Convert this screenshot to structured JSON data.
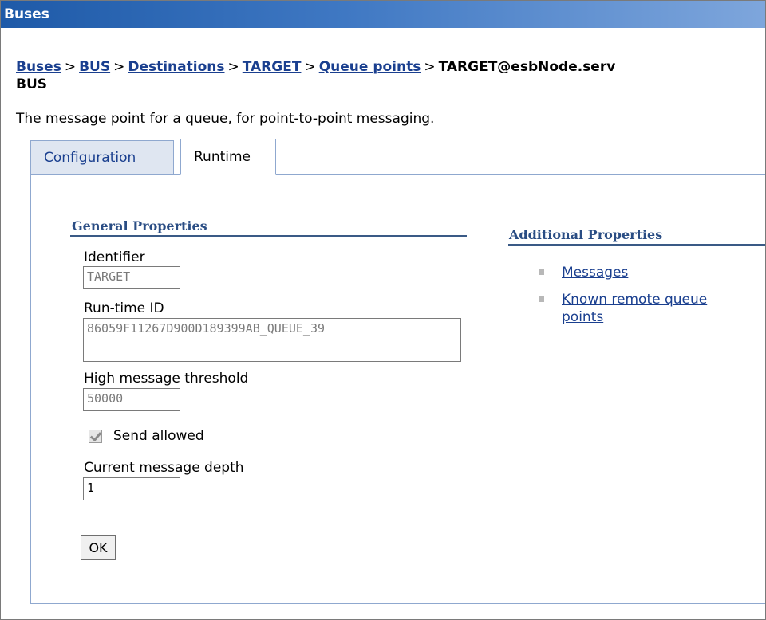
{
  "window": {
    "title": "Buses"
  },
  "breadcrumb": {
    "items": [
      {
        "label": "Buses",
        "link": true
      },
      {
        "label": "BUS",
        "link": true
      },
      {
        "label": "Destinations",
        "link": true
      },
      {
        "label": "TARGET",
        "link": true
      },
      {
        "label": "Queue points",
        "link": true
      }
    ],
    "separator": ">",
    "current_part1": "TARGET@esbNo",
    "current_part2": "de.serv",
    "current_line2": "BUS"
  },
  "description": "The message point for a queue, for point-to-point messaging.",
  "tabs": [
    {
      "label": "Configuration",
      "active": false
    },
    {
      "label": "Runtime",
      "active": true
    }
  ],
  "general_properties": {
    "title": "General Properties",
    "identifier": {
      "label": "Identifier",
      "value": "TARGET"
    },
    "runtime_id": {
      "label": "Run-time ID",
      "value": "86059F11267D900D189399AB_QUEUE_39"
    },
    "high_message_threshold": {
      "label": "High message threshold",
      "value": "50000"
    },
    "send_allowed": {
      "label": "Send allowed",
      "checked": true
    },
    "current_message_depth": {
      "label": "Current message depth",
      "value": "1"
    },
    "ok_label": "OK"
  },
  "additional_properties": {
    "title": "Additional Properties",
    "links": [
      {
        "label": "Messages"
      },
      {
        "label_line1": "Known remote queue",
        "label_line2": "points"
      }
    ]
  },
  "colors": {
    "titlebar": "#1e5aa8",
    "link": "#1a3f8f",
    "section_title": "#2a4d84",
    "tab_inactive": "#dfe6f1"
  }
}
